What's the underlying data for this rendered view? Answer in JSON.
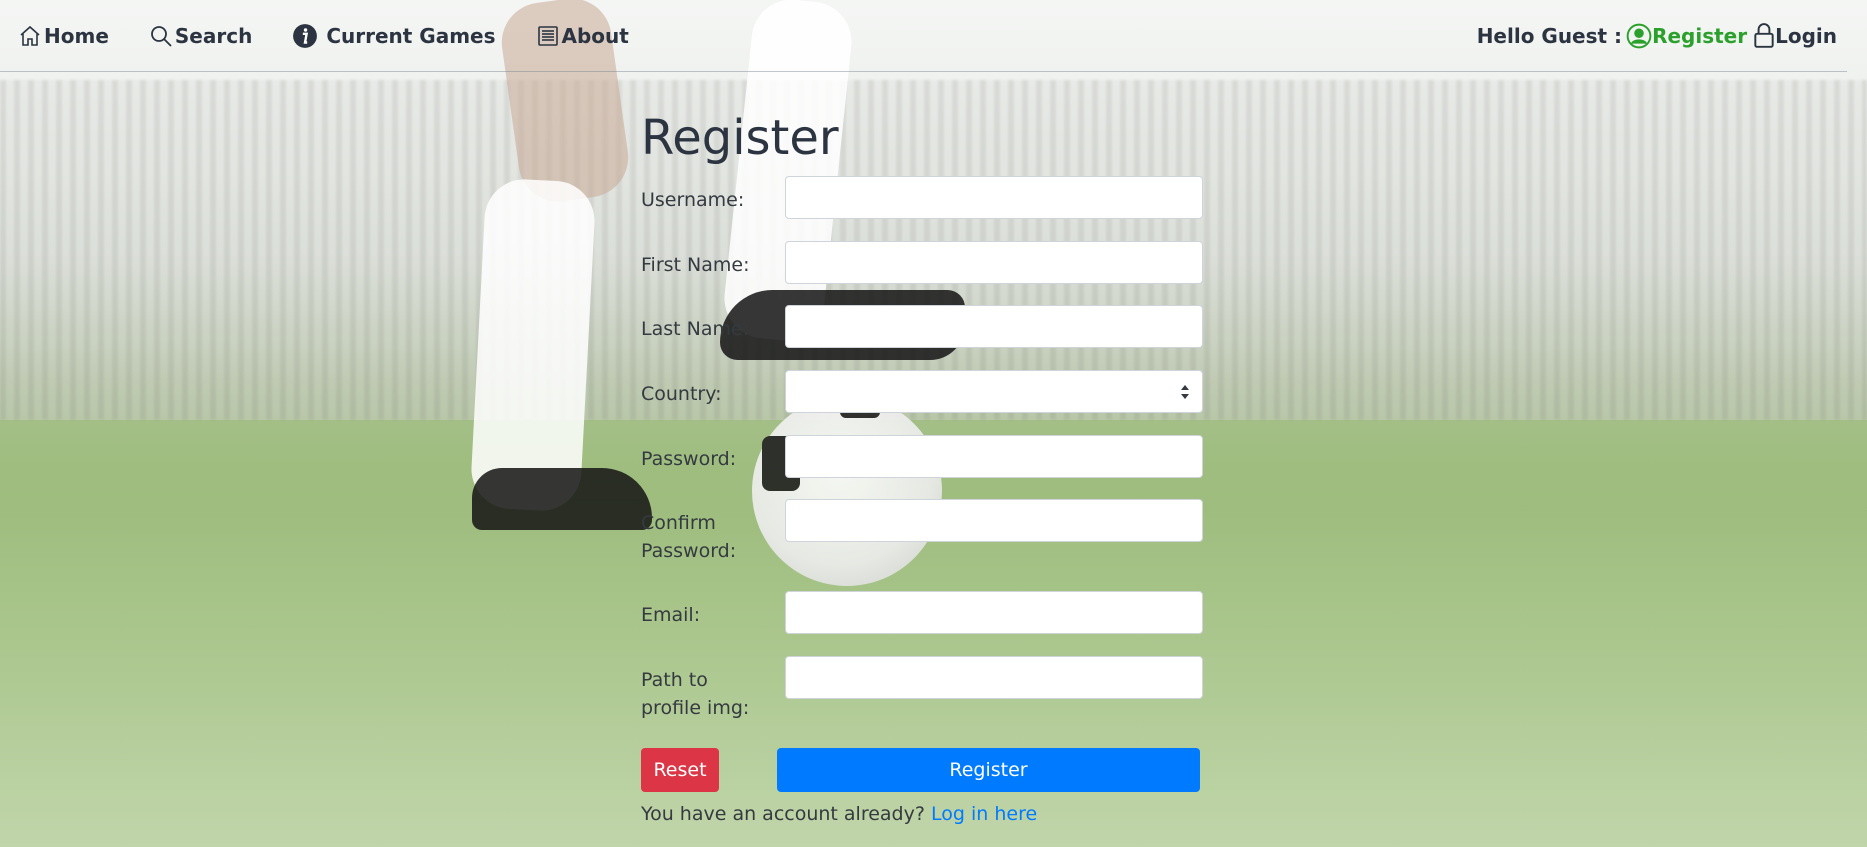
{
  "nav": {
    "home": "Home",
    "search": "Search",
    "current_games": "Current Games",
    "about": "About",
    "hello": "Hello Guest :",
    "register": "Register",
    "login": "Login"
  },
  "form": {
    "title": "Register",
    "fields": [
      {
        "label": "Username:",
        "value": ""
      },
      {
        "label": "First Name:",
        "value": ""
      },
      {
        "label": "Last Name:",
        "value": ""
      },
      {
        "label": "Country:",
        "value": ""
      },
      {
        "label": "Password:",
        "value": ""
      },
      {
        "label": "Confirm Password:",
        "value": ""
      },
      {
        "label": "Email:",
        "value": ""
      },
      {
        "label": "Path to profile img:",
        "value": ""
      }
    ],
    "reset_label": "Reset",
    "register_label": "Register",
    "account_prompt": "You have an account already?",
    "login_link": "Log in here"
  },
  "colors": {
    "text": "#2b3440",
    "register_green": "#2ca02c",
    "reset_red": "#dc3545",
    "primary_blue": "#007bff"
  },
  "icons": {
    "home": "home-icon",
    "search": "search-icon",
    "current_games": "info-icon",
    "about": "book-icon",
    "register": "user-circle-icon",
    "login": "lock-icon"
  }
}
